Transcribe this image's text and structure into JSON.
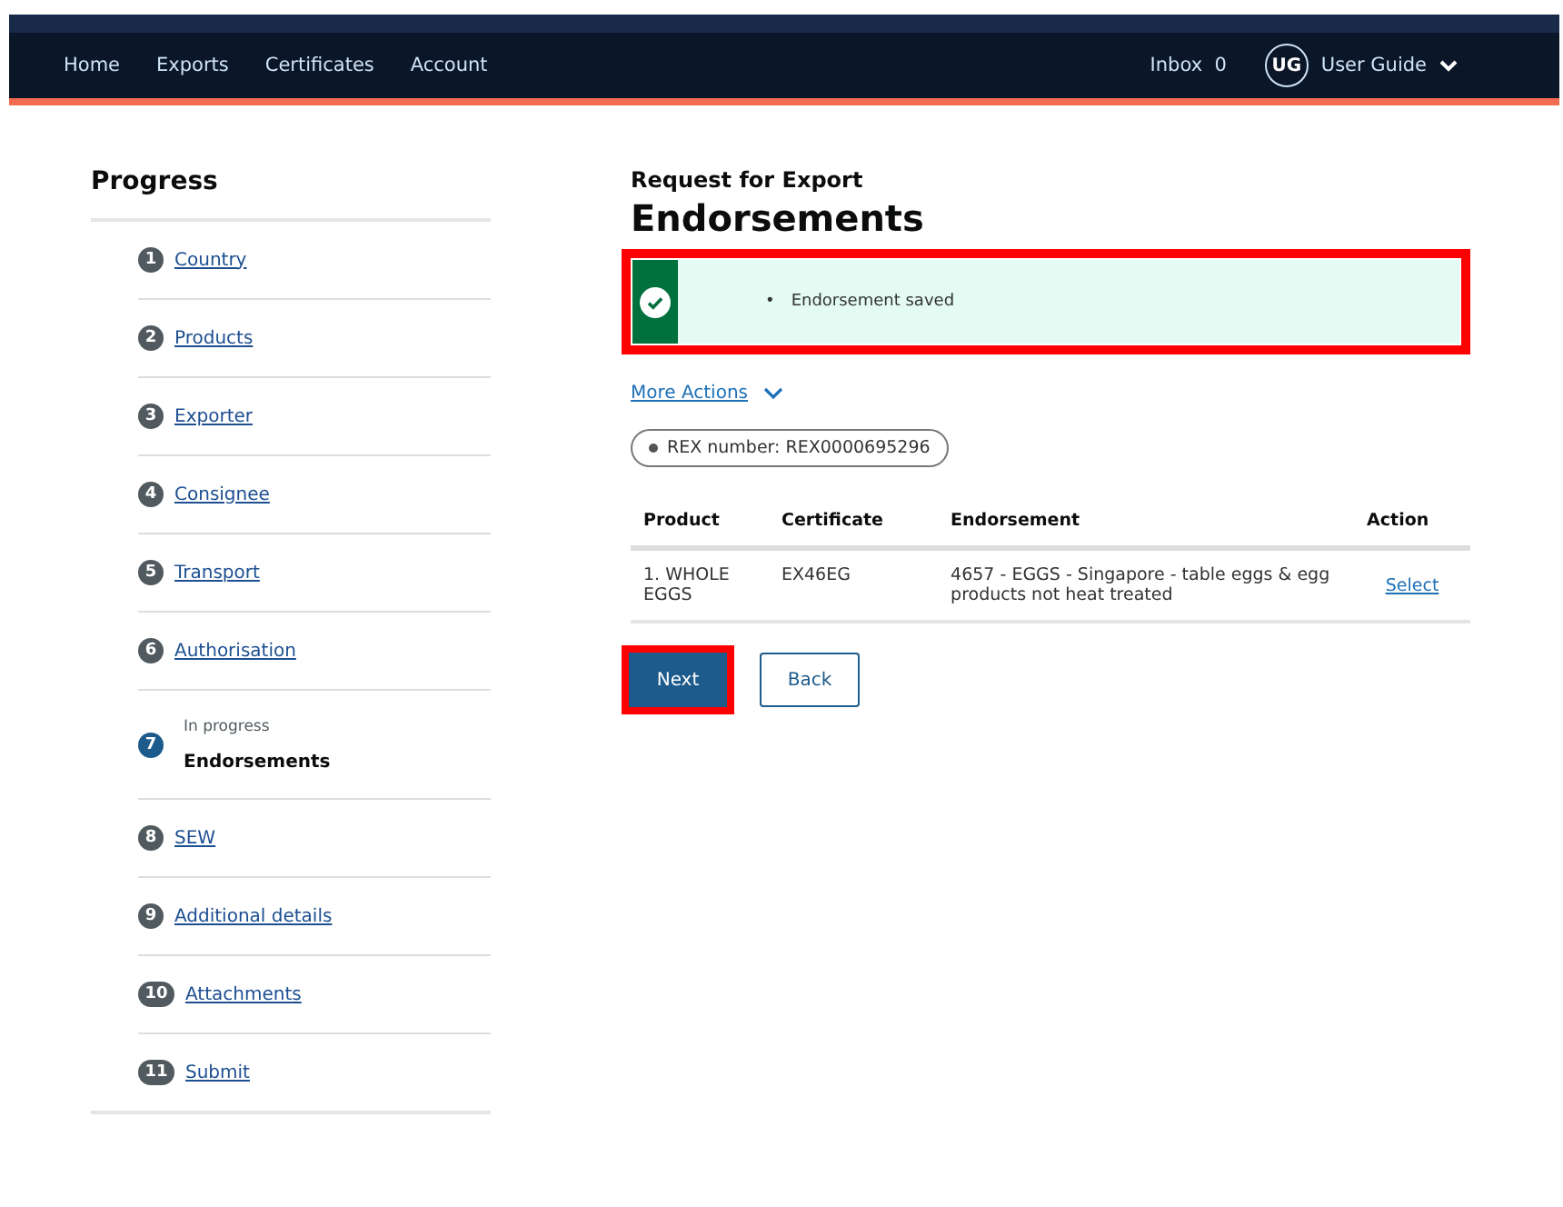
{
  "nav": {
    "links": [
      "Home",
      "Exports",
      "Certificates",
      "Account"
    ],
    "inbox_label": "Inbox",
    "inbox_count": "0",
    "user_initials": "UG",
    "user_name": "User Guide"
  },
  "progress": {
    "title": "Progress",
    "steps": [
      {
        "number": "1",
        "label": "Country",
        "selected": false
      },
      {
        "number": "2",
        "label": "Products",
        "selected": false
      },
      {
        "number": "3",
        "label": "Exporter",
        "selected": false
      },
      {
        "number": "4",
        "label": "Consignee",
        "selected": false
      },
      {
        "number": "5",
        "label": "Transport",
        "selected": false
      },
      {
        "number": "6",
        "label": "Authorisation",
        "selected": false
      },
      {
        "number": "7",
        "label": "Endorsements",
        "selected": true,
        "status": "In progress"
      },
      {
        "number": "8",
        "label": "SEW",
        "selected": false
      },
      {
        "number": "9",
        "label": "Additional details",
        "selected": false
      },
      {
        "number": "10",
        "label": "Attachments",
        "selected": false
      },
      {
        "number": "11",
        "label": "Submit",
        "selected": false
      }
    ]
  },
  "main": {
    "caption": "Request for Export",
    "title": "Endorsements",
    "alert": {
      "kind": "success",
      "messages": [
        {
          "bullet": "•",
          "text": "Endorsement saved"
        }
      ],
      "highlighted": true
    },
    "more_actions": "More Actions",
    "tag": "REX number: REX0000695296",
    "table": {
      "columns": [
        "Product",
        "Certificate",
        "Endorsement",
        "Action"
      ],
      "rows": [
        {
          "product": "1. WHOLE EGGS",
          "certificate": "EX46EG",
          "endorsement": "4657 - EGGS - Singapore - table eggs & egg products not heat treated",
          "action": "Select"
        }
      ]
    },
    "buttons": [
      {
        "label": "Next",
        "kind": "primary",
        "highlighted": true
      },
      {
        "label": "Back",
        "kind": "secondary",
        "highlighted": false
      }
    ]
  }
}
